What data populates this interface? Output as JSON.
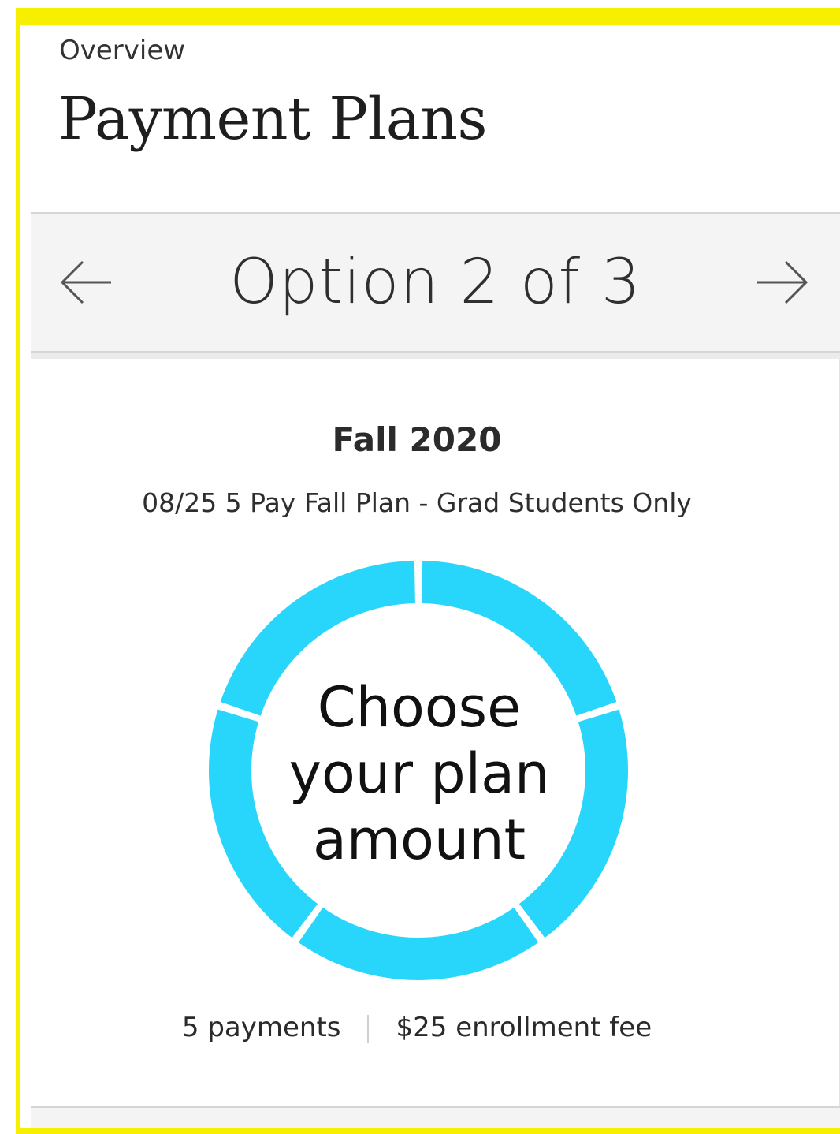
{
  "header": {
    "breadcrumb": "Overview",
    "title": "Payment Plans"
  },
  "option_nav": {
    "label": "Option 2 of 3",
    "prev_icon": "arrow-left-icon",
    "next_icon": "arrow-right-icon"
  },
  "plan": {
    "term": "Fall 2020",
    "name": "08/25 5 Pay Fall Plan - Grad Students Only",
    "donut": {
      "segments": 5,
      "color": "#29d6fb",
      "center_lines": [
        "Choose",
        "your plan",
        "amount"
      ]
    },
    "payments": "5 payments",
    "enrollment_fee": "$25 enrollment fee"
  },
  "colors": {
    "highlight_frame": "#f7ef00",
    "nav_background": "#f4f4f4",
    "donut": "#29d6fb"
  }
}
